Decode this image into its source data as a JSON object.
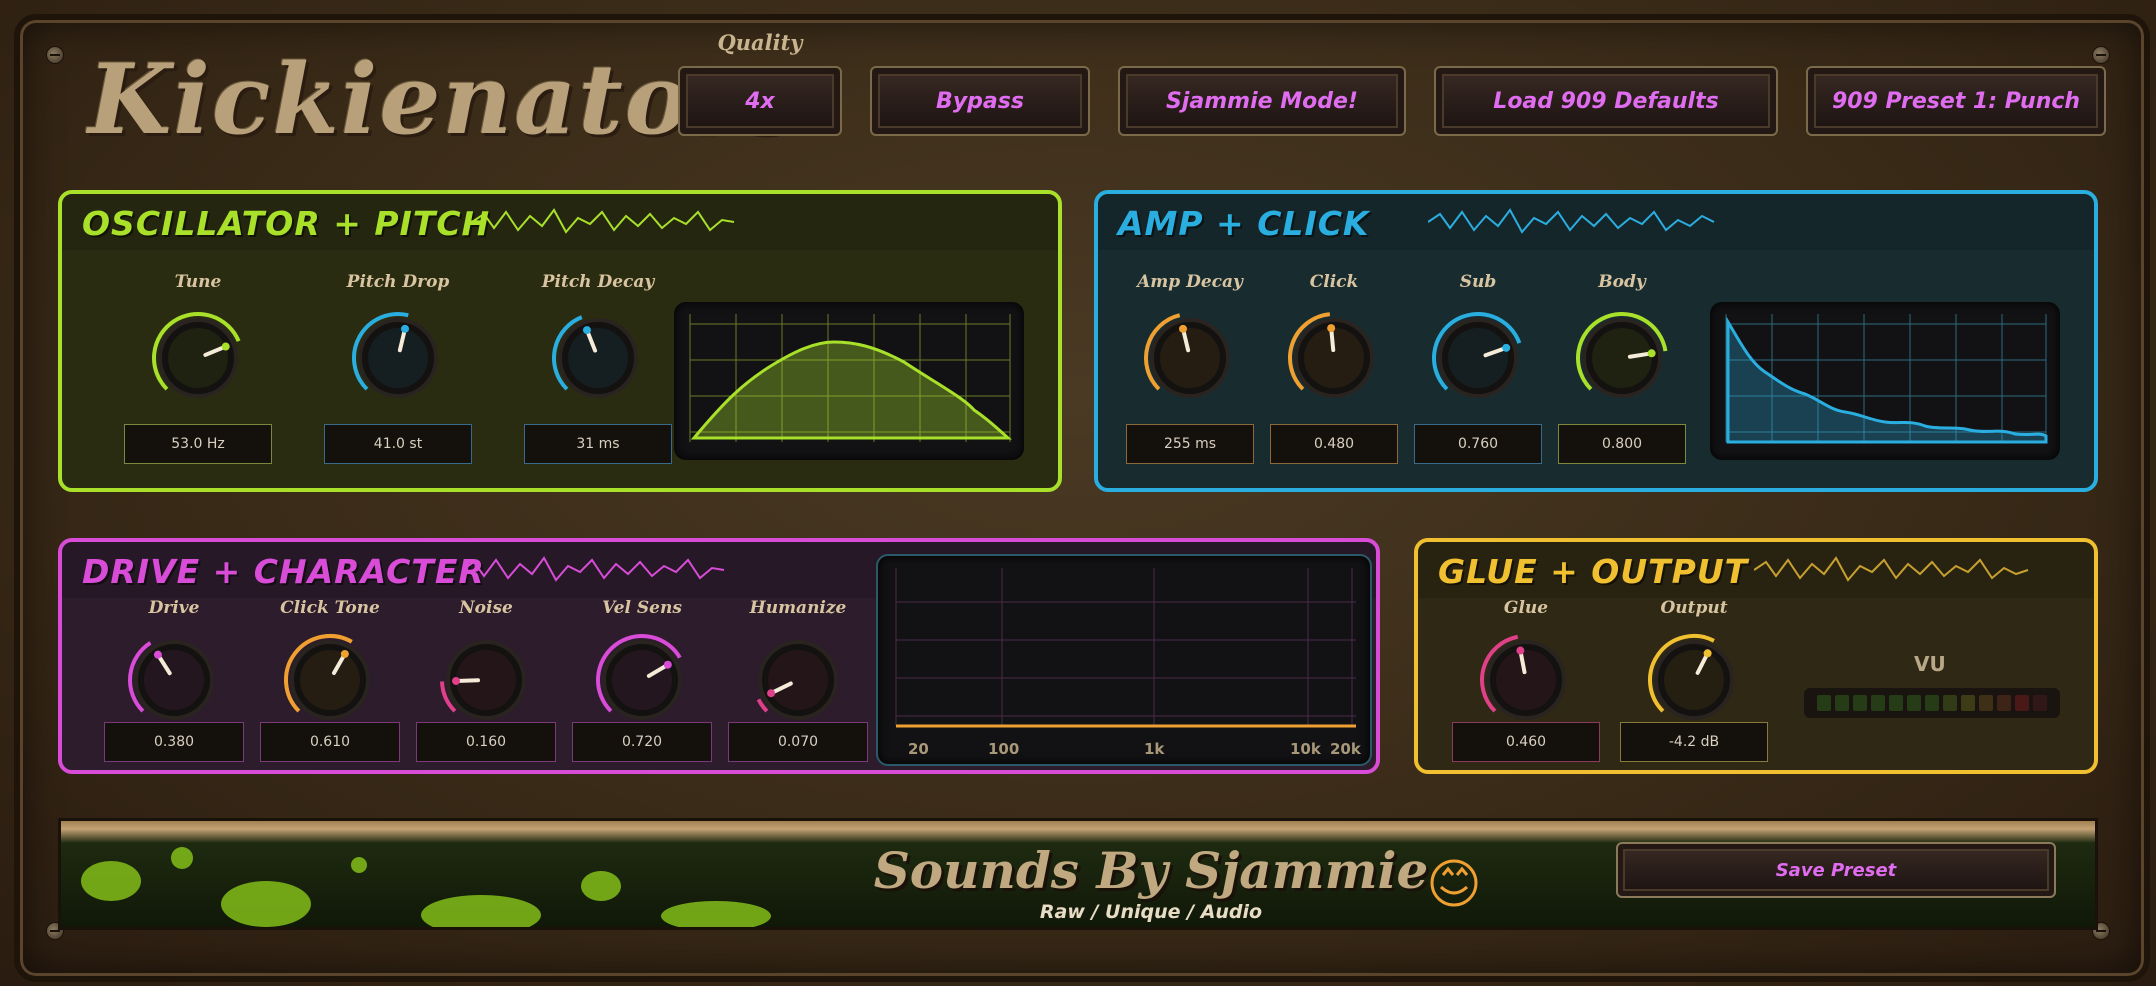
{
  "header": {
    "logo": "Kickienators",
    "quality_label": "Quality",
    "buttons": [
      "4x",
      "Bypass",
      "Sjammie Mode!",
      "Load 909 Defaults",
      "909 Preset 1: Punch"
    ]
  },
  "colors": {
    "oscillator": "#a8e02a",
    "amp": "#2aaee0",
    "drive": "#d84cd8",
    "glue": "#f0c030",
    "orange": "#f0a030",
    "pink": "#e0408a",
    "button_text": "#e06cf0"
  },
  "panels": {
    "oscillator": {
      "title": "OSCILLATOR + PITCH",
      "knobs": [
        {
          "label": "Tune",
          "value": "53.0 Hz",
          "level": 0.75,
          "color": "#a8e02a",
          "border": "#7a8a3a"
        },
        {
          "label": "Pitch Drop",
          "value": "41.0 st",
          "level": 0.55,
          "color": "#2aaee0",
          "border": "#3a6a8a"
        },
        {
          "label": "Pitch Decay",
          "value": "31 ms",
          "level": 0.42,
          "color": "#2aaee0",
          "border": "#3a6a8a"
        }
      ]
    },
    "amp": {
      "title": "AMP + CLICK",
      "knobs": [
        {
          "label": "Amp Decay",
          "value": "255 ms",
          "level": 0.45,
          "color": "#f0a030",
          "border": "#8a6a3a"
        },
        {
          "label": "Click",
          "value": "0.480",
          "level": 0.48,
          "color": "#f0a030",
          "border": "#8a6a3a"
        },
        {
          "label": "Sub",
          "value": "0.760",
          "level": 0.76,
          "color": "#2aaee0",
          "border": "#3a6a8a"
        },
        {
          "label": "Body",
          "value": "0.800",
          "level": 0.8,
          "color": "#a8e02a",
          "border": "#7a8a3a"
        }
      ]
    },
    "drive": {
      "title": "DRIVE + CHARACTER",
      "knobs": [
        {
          "label": "Drive",
          "value": "0.380",
          "level": 0.38,
          "color": "#d84cd8",
          "border": "#7a3a7a"
        },
        {
          "label": "Click Tone",
          "value": "0.610",
          "level": 0.61,
          "color": "#f0a030",
          "border": "#7a3a7a"
        },
        {
          "label": "Noise",
          "value": "0.160",
          "level": 0.16,
          "color": "#e0408a",
          "border": "#7a3a7a"
        },
        {
          "label": "Vel Sens",
          "value": "0.720",
          "level": 0.72,
          "color": "#d84cd8",
          "border": "#7a3a7a"
        },
        {
          "label": "Humanize",
          "value": "0.070",
          "level": 0.07,
          "color": "#e0408a",
          "border": "#7a3a7a"
        }
      ],
      "spectrum_ticks": [
        "20",
        "100",
        "1k",
        "10k",
        "20k"
      ]
    },
    "glue": {
      "title": "GLUE + OUTPUT",
      "knobs": [
        {
          "label": "Glue",
          "value": "0.460",
          "level": 0.46,
          "color": "#e0408a",
          "border": "#8a3a5a"
        },
        {
          "label": "Output",
          "value": "-4.2 dB",
          "level": 0.6,
          "color": "#f0c030",
          "border": "#8a7a3a"
        }
      ],
      "vu_label": "VU",
      "vu_level": 0
    }
  },
  "footer": {
    "title": "Sounds By Sjammie",
    "subtitle": "Raw / Unique / Audio",
    "save_button": "Save Preset"
  }
}
